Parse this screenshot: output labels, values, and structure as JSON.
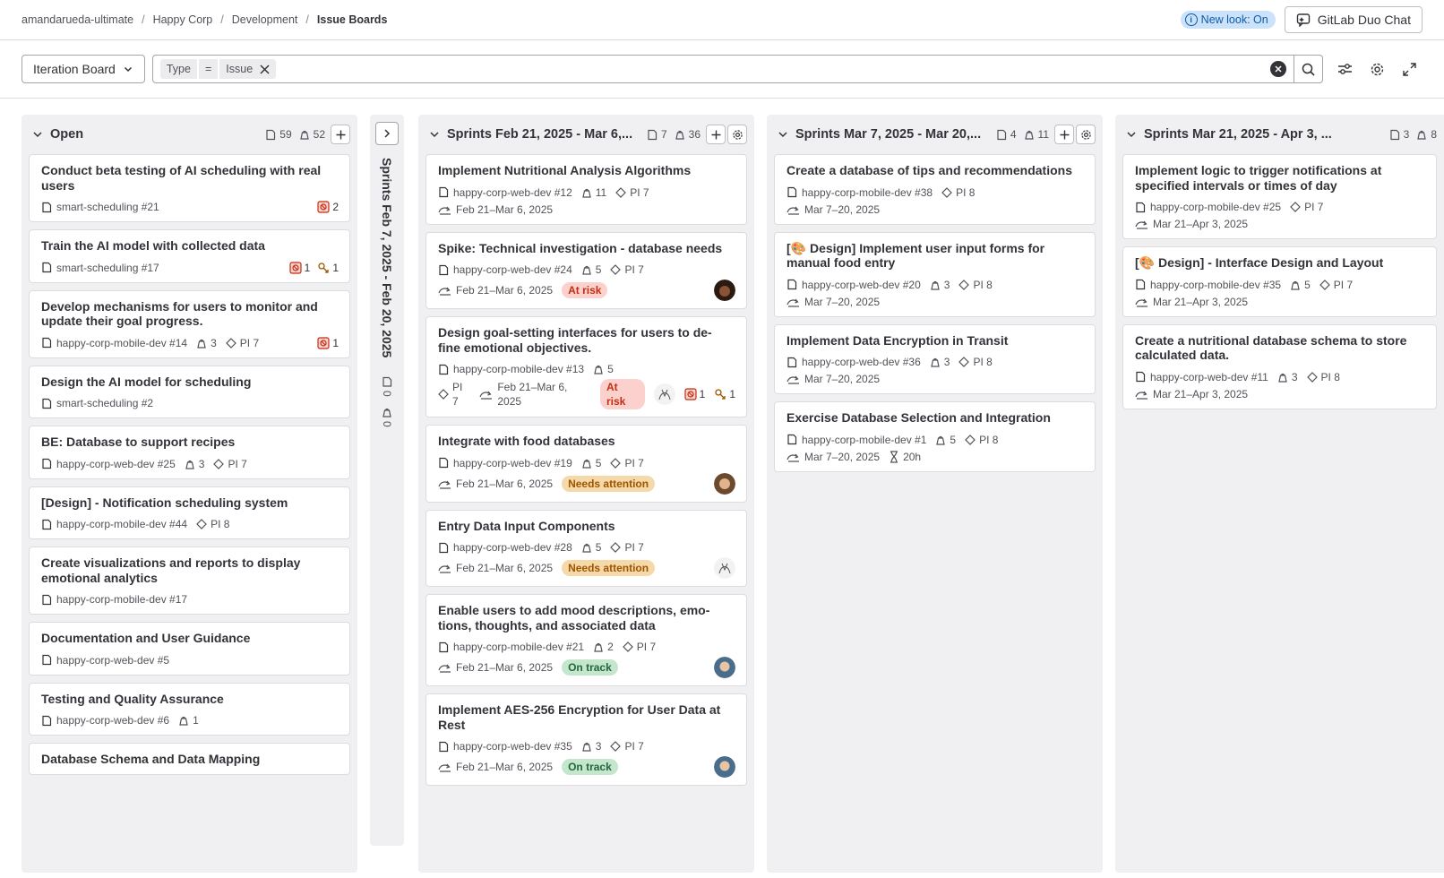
{
  "breadcrumbs": [
    "amandarueda-ultimate",
    "Happy Corp",
    "Development",
    "Issue Boards"
  ],
  "header": {
    "new_look": "New look: On",
    "duo_chat": "GitLab Duo Chat"
  },
  "filter": {
    "board_name": "Iteration Board",
    "token_field": "Type",
    "token_operator": "=",
    "token_value": "Issue",
    "search_placeholder": ""
  },
  "lists": [
    {
      "title": "Open",
      "issues_count": "59",
      "weight": "52",
      "cards": [
        {
          "title": "Conduct beta testing of AI scheduling with real users",
          "ref": "smart-scheduling #21",
          "blocked": "2"
        },
        {
          "title": "Train the AI model with collected data",
          "ref": "smart-scheduling #17",
          "blocked": "1",
          "blocking": "1"
        },
        {
          "title": "Develop mechanisms for users to monitor and update their goal progress.",
          "ref": "happy-corp-mobile-dev #14",
          "weight": "3",
          "milestone": "PI 7",
          "blocked": "1"
        },
        {
          "title": "Design the AI model for scheduling",
          "ref": "smart-scheduling #2"
        },
        {
          "title": "BE: Database to support recipes",
          "ref": "happy-corp-web-dev #25",
          "weight": "3",
          "milestone": "PI 7"
        },
        {
          "title": "[Design] - Notification scheduling system",
          "ref": "happy-corp-mobile-dev #44",
          "milestone": "PI 8"
        },
        {
          "title": "Create visualizations and reports to display emotional analytics",
          "ref": "happy-corp-mobile-dev #17"
        },
        {
          "title": "Documentation and User Guidance",
          "ref": "happy-corp-web-dev #5"
        },
        {
          "title": "Testing and Quality Assurance",
          "ref": "happy-corp-web-dev #6",
          "weight": "1"
        },
        {
          "title": "Database Schema and Data Mapping"
        }
      ]
    },
    {
      "title": "Sprints Feb 7, 2025 - Feb 20, 2025",
      "issues_count": "0",
      "weight": "0"
    },
    {
      "title": "Sprints Feb 21, 2025 - Mar 6,...",
      "issues_count": "7",
      "weight": "36",
      "cards": [
        {
          "title": "Implement Nutritional Analysis Algorithms",
          "ref": "happy-corp-web-dev #12",
          "weight": "11",
          "milestone": "PI 7",
          "iteration": "Feb 21–Mar 6, 2025"
        },
        {
          "title": "Spike: Technical investigation - database needs",
          "ref": "happy-corp-web-dev #24",
          "weight": "5",
          "milestone": "PI 7",
          "iteration": "Feb 21–Mar 6, 2025",
          "health": "At risk"
        },
        {
          "title": "Design goal-setting interfaces for users to de-fine emotional objectives.",
          "ref": "happy-corp-mobile-dev #13",
          "weight": "5",
          "milestone": "PI 7",
          "iteration": "Feb 21–Mar 6, 2025",
          "health": "At risk",
          "blocked": "1",
          "blocking": "1"
        },
        {
          "title": "Integrate with food databases",
          "ref": "happy-corp-web-dev #19",
          "weight": "5",
          "milestone": "PI 7",
          "iteration": "Feb 21–Mar 6, 2025",
          "health": "Needs attention"
        },
        {
          "title": "Entry Data Input Components",
          "ref": "happy-corp-web-dev #28",
          "weight": "5",
          "milestone": "PI 7",
          "iteration": "Feb 21–Mar 6, 2025",
          "health": "Needs attention"
        },
        {
          "title": "Enable users to add mood descriptions, emo-tions, thoughts, and associated data",
          "ref": "happy-corp-mobile-dev #21",
          "weight": "2",
          "milestone": "PI 7",
          "iteration": "Feb 21–Mar 6, 2025",
          "health": "On track"
        },
        {
          "title": "Implement AES-256 Encryption for User Data at Rest",
          "ref": "happy-corp-web-dev #35",
          "weight": "3",
          "milestone": "PI 7",
          "iteration": "Feb 21–Mar 6, 2025",
          "health": "On track"
        }
      ]
    },
    {
      "title": "Sprints Mar 7, 2025 - Mar 20,...",
      "issues_count": "4",
      "weight": "11",
      "cards": [
        {
          "title": "Create a database of tips and recommendations",
          "ref": "happy-corp-mobile-dev #38",
          "milestone": "PI 8",
          "iteration": "Mar 7–20, 2025"
        },
        {
          "title": "[🎨 Design] Implement user input forms for manual food entry",
          "ref": "happy-corp-web-dev #20",
          "weight": "3",
          "milestone": "PI 8",
          "iteration": "Mar 7–20, 2025"
        },
        {
          "title": "Implement Data Encryption in Transit",
          "ref": "happy-corp-web-dev #36",
          "weight": "3",
          "milestone": "PI 8",
          "iteration": "Mar 7–20, 2025"
        },
        {
          "title": "Exercise Database Selection and Integration",
          "ref": "happy-corp-mobile-dev #1",
          "weight": "5",
          "milestone": "PI 8",
          "iteration": "Mar 7–20, 2025",
          "time_estimate": "20h"
        }
      ]
    },
    {
      "title": "Sprints Mar 21, 2025 - Apr 3, ...",
      "issues_count": "3",
      "weight": "8",
      "cards": [
        {
          "title": "Implement logic to trigger notifications at specified intervals or times of day",
          "ref": "happy-corp-mobile-dev #25",
          "milestone": "PI 7",
          "iteration": "Mar 21–Apr 3, 2025"
        },
        {
          "title": "[🎨 Design] - Interface Design and Layout",
          "ref": "happy-corp-mobile-dev #35",
          "weight": "5",
          "milestone": "PI 7",
          "iteration": "Mar 21–Apr 3, 2025"
        },
        {
          "title": "Create a nutritional database schema to store calculated data.",
          "ref": "happy-corp-web-dev #11",
          "weight": "3",
          "milestone": "PI 8",
          "iteration": "Mar 21–Apr 3, 2025"
        }
      ]
    }
  ],
  "colors": {
    "at_risk": "#c02f12",
    "needs_attention": "#9e5400",
    "on_track": "#24663b",
    "list_bg": "#f0f0f2"
  }
}
